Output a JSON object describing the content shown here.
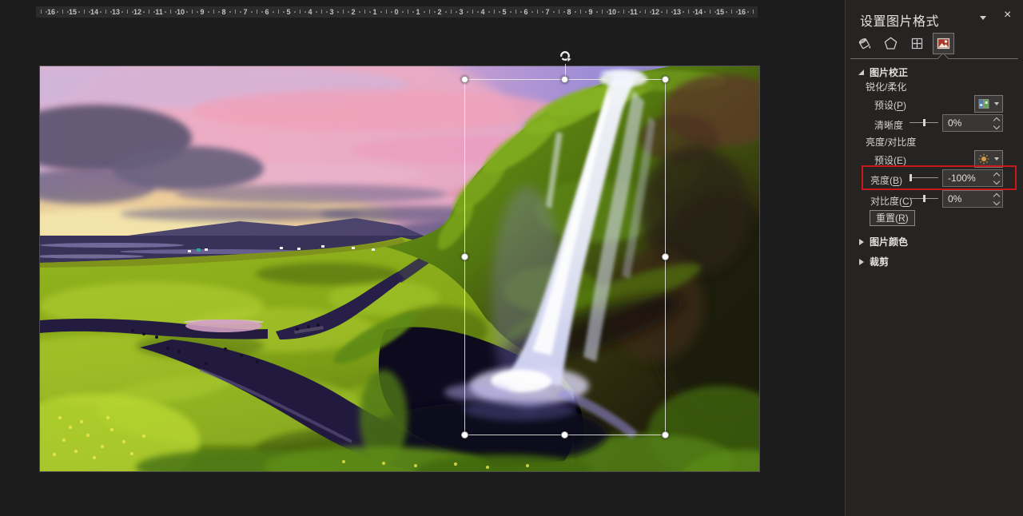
{
  "ruler": {
    "numbers": [
      16,
      15,
      14,
      13,
      12,
      11,
      10,
      9,
      8,
      7,
      6,
      5,
      4,
      3,
      2,
      1,
      0,
      1,
      2,
      3,
      4,
      5,
      6,
      7,
      8,
      9,
      10,
      11,
      12,
      13,
      14,
      15,
      16
    ]
  },
  "slide": {
    "picture_description": "Seljalandsfoss waterfall photo: pink-purple sunset sky, green mossy cliff, white waterfall, green meadows with dark winding river"
  },
  "pane": {
    "title": "设置图片格式",
    "close_glyph": "×",
    "tabs": [
      {
        "icon": "fill-and-line-icon",
        "selected": false
      },
      {
        "icon": "effects-icon",
        "selected": false
      },
      {
        "icon": "size-and-properties-icon",
        "selected": false
      },
      {
        "icon": "picture-icon",
        "selected": true
      }
    ],
    "picture_correction": {
      "header": "图片校正",
      "sharpen_soften_label": "锐化/柔化",
      "preset_sharpen": {
        "label": {
          "text": "预设",
          "key": "P"
        },
        "icon": "sharpen-preset-thumbnail-icon"
      },
      "sharpness": {
        "label": "清晰度",
        "value": "0%",
        "slider_position": 0.5
      },
      "brightness_contrast_label": "亮度/对比度",
      "preset_brightness": {
        "label": {
          "text": "预设",
          "key": "E"
        },
        "icon": "sun-icon"
      },
      "brightness": {
        "label": {
          "text": "亮度",
          "key": "B"
        },
        "value": "-100%",
        "slider_position": 0,
        "highlighted": true
      },
      "contrast": {
        "label": {
          "text": "对比度",
          "key": "C"
        },
        "value": "0%",
        "slider_position": 0.5
      },
      "reset_button": {
        "label": {
          "text": "重置",
          "key": "R"
        }
      }
    },
    "picture_color_header": "图片颜色",
    "crop_header": "裁剪"
  },
  "colors": {
    "highlight_red": "#c9191e",
    "pane_background": "#252423",
    "canvas_background": "#1c1c1c",
    "picture_icon_red": "#a8392a",
    "sun_icon_orange": "#d79c43"
  }
}
